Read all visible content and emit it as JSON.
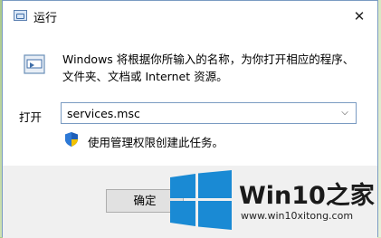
{
  "window": {
    "title": "运行",
    "close_label": "✕"
  },
  "content": {
    "description": "Windows 将根据你所输入的名称，为你打开相应的程序、文件夹、文档或 Internet 资源。",
    "open_label": "打开",
    "open_value": "services.msc",
    "admin_note": "使用管理权限创建此任务。"
  },
  "buttons": {
    "ok_label": "确定"
  },
  "watermark": {
    "title": "Win10之家",
    "url": "www.win10xitong.com"
  },
  "colors": {
    "accent": "#1a8ad4",
    "border": "#7a9bc2"
  }
}
